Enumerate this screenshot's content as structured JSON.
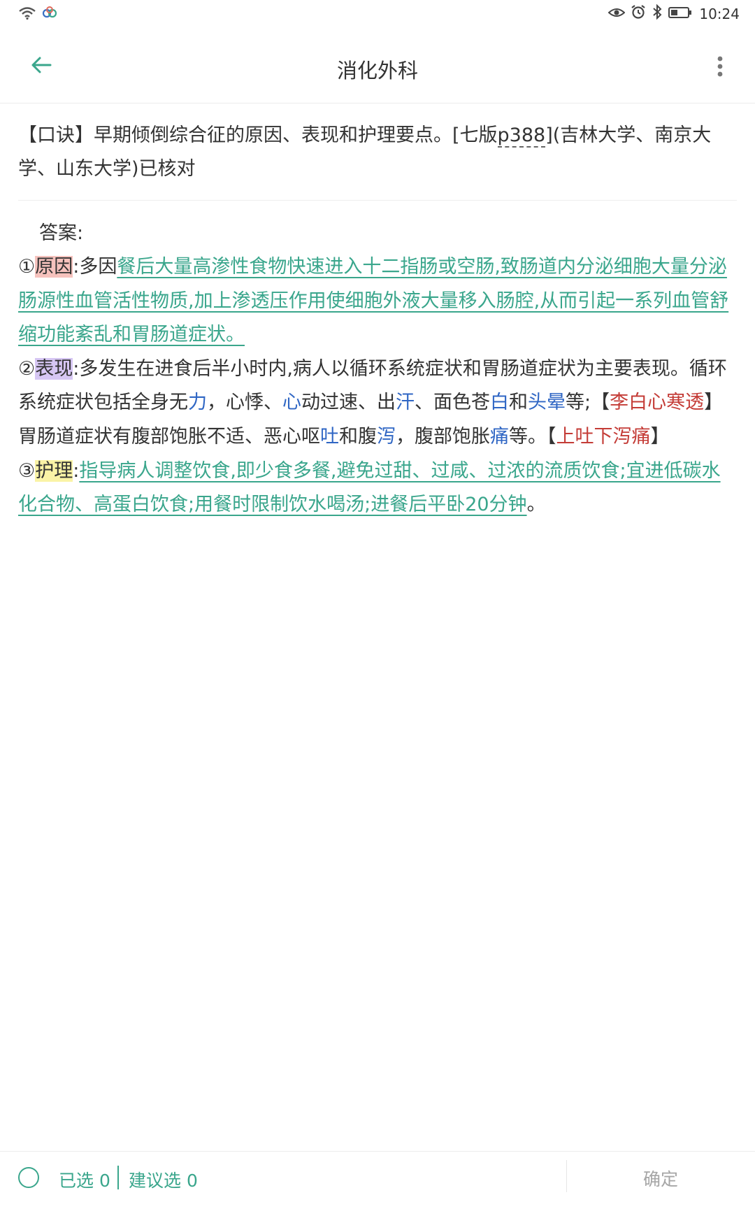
{
  "status_bar": {
    "time": "10:24"
  },
  "app_bar": {
    "title": "消化外科"
  },
  "question": {
    "part1": "【口诀】早期倾倒综合征的原因、表现和护理要点。[七版",
    "page_ref": "p388",
    "part2": "](吉林大学、南京大学、山东大学)已核对"
  },
  "answer": {
    "label": "答案:",
    "p1": {
      "num": "①",
      "tag": "原因",
      "t1": ":多因",
      "u1": "餐后大量高渗性食物快速进入十二指肠或空肠,致肠道内分泌细胞大量分泌肠源性血管活性物质,加上渗透压作用使细胞外液大量移入肠腔,从而引起一系列血管舒缩功能紊乱和胃肠道症状。"
    },
    "p2": {
      "num": "②",
      "tag": "表现",
      "s1": ":多发生在进食后半小时内,病人以循环系统症状和胃肠道症状为主要表现。循环系统症状包括全身无",
      "k1": "力",
      "s2": "，心悸、",
      "k2": "心",
      "s3": "动过速、出",
      "k3": "汗",
      "s4": "、面色苍",
      "k4": "白",
      "s5": "和",
      "k5": "头晕",
      "s6": "等;【",
      "r1": "李白心寒透",
      "s7": "】胃肠道症状有腹部饱胀不适、恶心呕",
      "k6": "吐",
      "s8": "和腹",
      "k7": "泻",
      "s9": "，腹部饱胀",
      "k8": "痛",
      "s10": "等。【",
      "r2": "上吐下泻痛",
      "s11": "】"
    },
    "p3": {
      "num": "③",
      "tag": "护理",
      "colon": ":",
      "u1": "指导病人调整饮食,即少食多餐,避免过甜、过咸、过浓的流质饮食;宜进低碳水化合物、高蛋白饮食;用餐时限制饮水喝汤;进餐后平卧20分钟",
      "end": "。"
    }
  },
  "bottom_bar": {
    "selected": "已选 0",
    "suggested": "建议选 0",
    "confirm": "确定"
  },
  "colors": {
    "accent": "#3aa68c",
    "keyword_blue": "#2f66c4",
    "keyword_red": "#c43c37"
  }
}
